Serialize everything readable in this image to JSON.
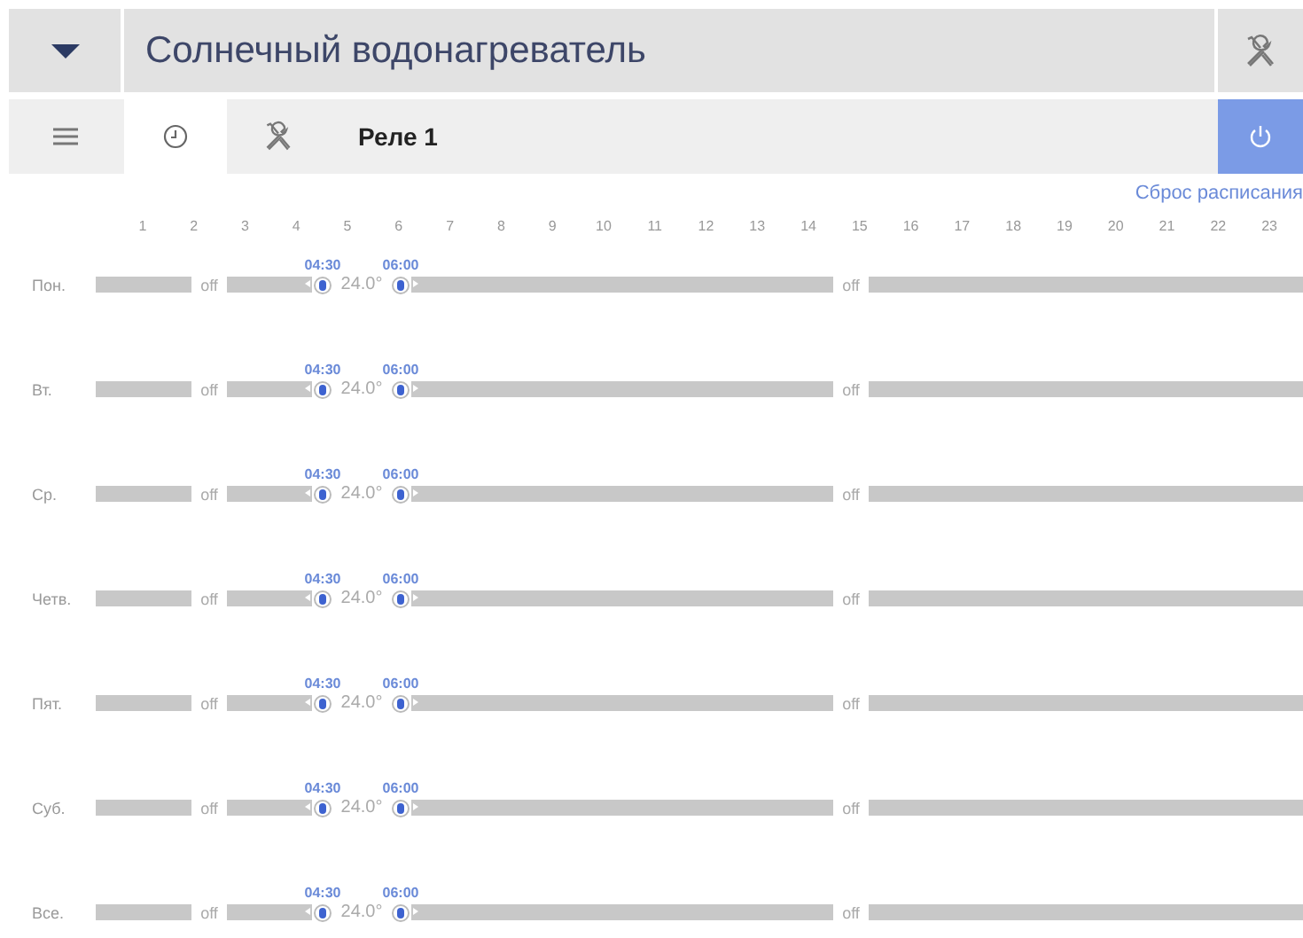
{
  "header": {
    "title": "Солнечный водонагреватель"
  },
  "tabs": [
    {
      "kind": "menu",
      "selected": false
    },
    {
      "kind": "clock",
      "selected": true
    },
    {
      "kind": "tools",
      "selected": false
    }
  ],
  "relay": {
    "label": "Реле 1",
    "power_on": true
  },
  "reset_link": "Сброс расписания",
  "hours": [
    "1",
    "2",
    "3",
    "4",
    "5",
    "6",
    "7",
    "8",
    "9",
    "10",
    "11",
    "12",
    "13",
    "14",
    "15",
    "16",
    "17",
    "18",
    "19",
    "20",
    "21",
    "22",
    "23"
  ],
  "days": [
    {
      "day": "Пон.",
      "off_1": "off",
      "start": "04:30",
      "end": "06:00",
      "temp": "24.0°",
      "off_2": "off"
    },
    {
      "day": "Вт.",
      "off_1": "off",
      "start": "04:30",
      "end": "06:00",
      "temp": "24.0°",
      "off_2": "off"
    },
    {
      "day": "Ср.",
      "off_1": "off",
      "start": "04:30",
      "end": "06:00",
      "temp": "24.0°",
      "off_2": "off"
    },
    {
      "day": "Четв.",
      "off_1": "off",
      "start": "04:30",
      "end": "06:00",
      "temp": "24.0°",
      "off_2": "off"
    },
    {
      "day": "Пят.",
      "off_1": "off",
      "start": "04:30",
      "end": "06:00",
      "temp": "24.0°",
      "off_2": "off"
    },
    {
      "day": "Суб.",
      "off_1": "off",
      "start": "04:30",
      "end": "06:00",
      "temp": "24.0°",
      "off_2": "off"
    },
    {
      "day": "Все.",
      "off_1": "off",
      "start": "04:30",
      "end": "06:00",
      "temp": "24.0°",
      "off_2": "off"
    }
  ]
}
